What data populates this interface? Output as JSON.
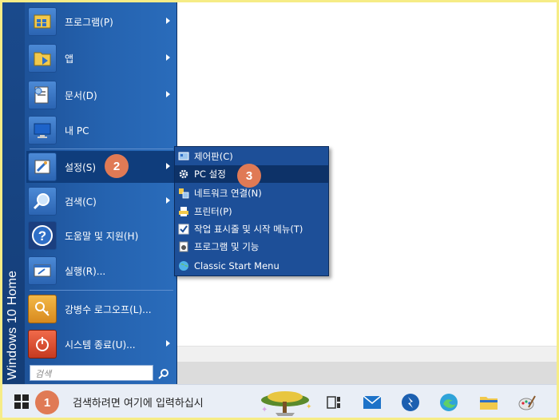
{
  "side_label": "Windows 10 Home",
  "start_menu": {
    "items": [
      {
        "label": "프로그램(P)",
        "icon": "programs-icon",
        "arrow": true
      },
      {
        "label": "앱",
        "icon": "apps-folder-icon",
        "arrow": true
      },
      {
        "label": "문서(D)",
        "icon": "documents-icon",
        "arrow": true
      },
      {
        "label": "내 PC",
        "icon": "computer-icon",
        "arrow": false
      },
      {
        "label": "설정(S)",
        "icon": "settings-icon",
        "arrow": true
      },
      {
        "label": "검색(C)",
        "icon": "search-icon",
        "arrow": true
      },
      {
        "label": "도움말 및 지원(H)",
        "icon": "help-icon",
        "arrow": false
      },
      {
        "label": "실행(R)...",
        "icon": "run-icon",
        "arrow": false
      },
      {
        "label": "강병수 로그오프(L)...",
        "icon": "logoff-icon",
        "arrow": false
      },
      {
        "label": "시스템 종료(U)...",
        "icon": "shutdown-icon",
        "arrow": true
      }
    ],
    "search_placeholder": "검색"
  },
  "submenu": {
    "items": [
      {
        "label": "제어판(C)",
        "icon": "control-panel-icon"
      },
      {
        "label": "PC 설정",
        "icon": "gear-icon"
      },
      {
        "label": "네트워크 연결(N)",
        "icon": "network-icon"
      },
      {
        "label": "프린터(P)",
        "icon": "printer-icon"
      },
      {
        "label": "작업 표시줄 및 시작 메뉴(T)",
        "icon": "taskbar-checkbox-icon"
      },
      {
        "label": "프로그램 및 기능",
        "icon": "programs-features-icon"
      },
      {
        "label": "Classic Start Menu",
        "icon": "globe-icon"
      }
    ]
  },
  "badges": [
    "1",
    "2",
    "3"
  ],
  "taskbar": {
    "search_text": "검색하려면 여기에 입력하십시",
    "icons": [
      "task-view-icon",
      "mail-icon",
      "app-blue-icon",
      "edge-icon",
      "file-explorer-icon",
      "paint-icon"
    ]
  },
  "colors": {
    "menu_blue": "#2563b0",
    "highlight": "#0f3d7c",
    "badge": "#e07a55",
    "frame": "#f6ec86"
  }
}
